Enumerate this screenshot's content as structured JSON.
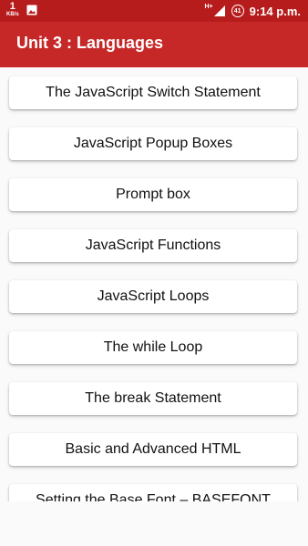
{
  "status_bar": {
    "data_rate_value": "1",
    "data_rate_unit": "KB/s",
    "network_type": "H+",
    "battery_level": "41",
    "time": "9:14 p.m."
  },
  "toolbar": {
    "title": "Unit 3 : Languages",
    "color": "#c62828"
  },
  "topics": [
    "The JavaScript Switch Statement",
    "JavaScript Popup Boxes",
    "Prompt box",
    "JavaScript Functions",
    "JavaScript Loops",
    "The while Loop",
    "The break Statement",
    "Basic and Advanced HTML",
    "Setting the Base Font – BASEFONT"
  ]
}
